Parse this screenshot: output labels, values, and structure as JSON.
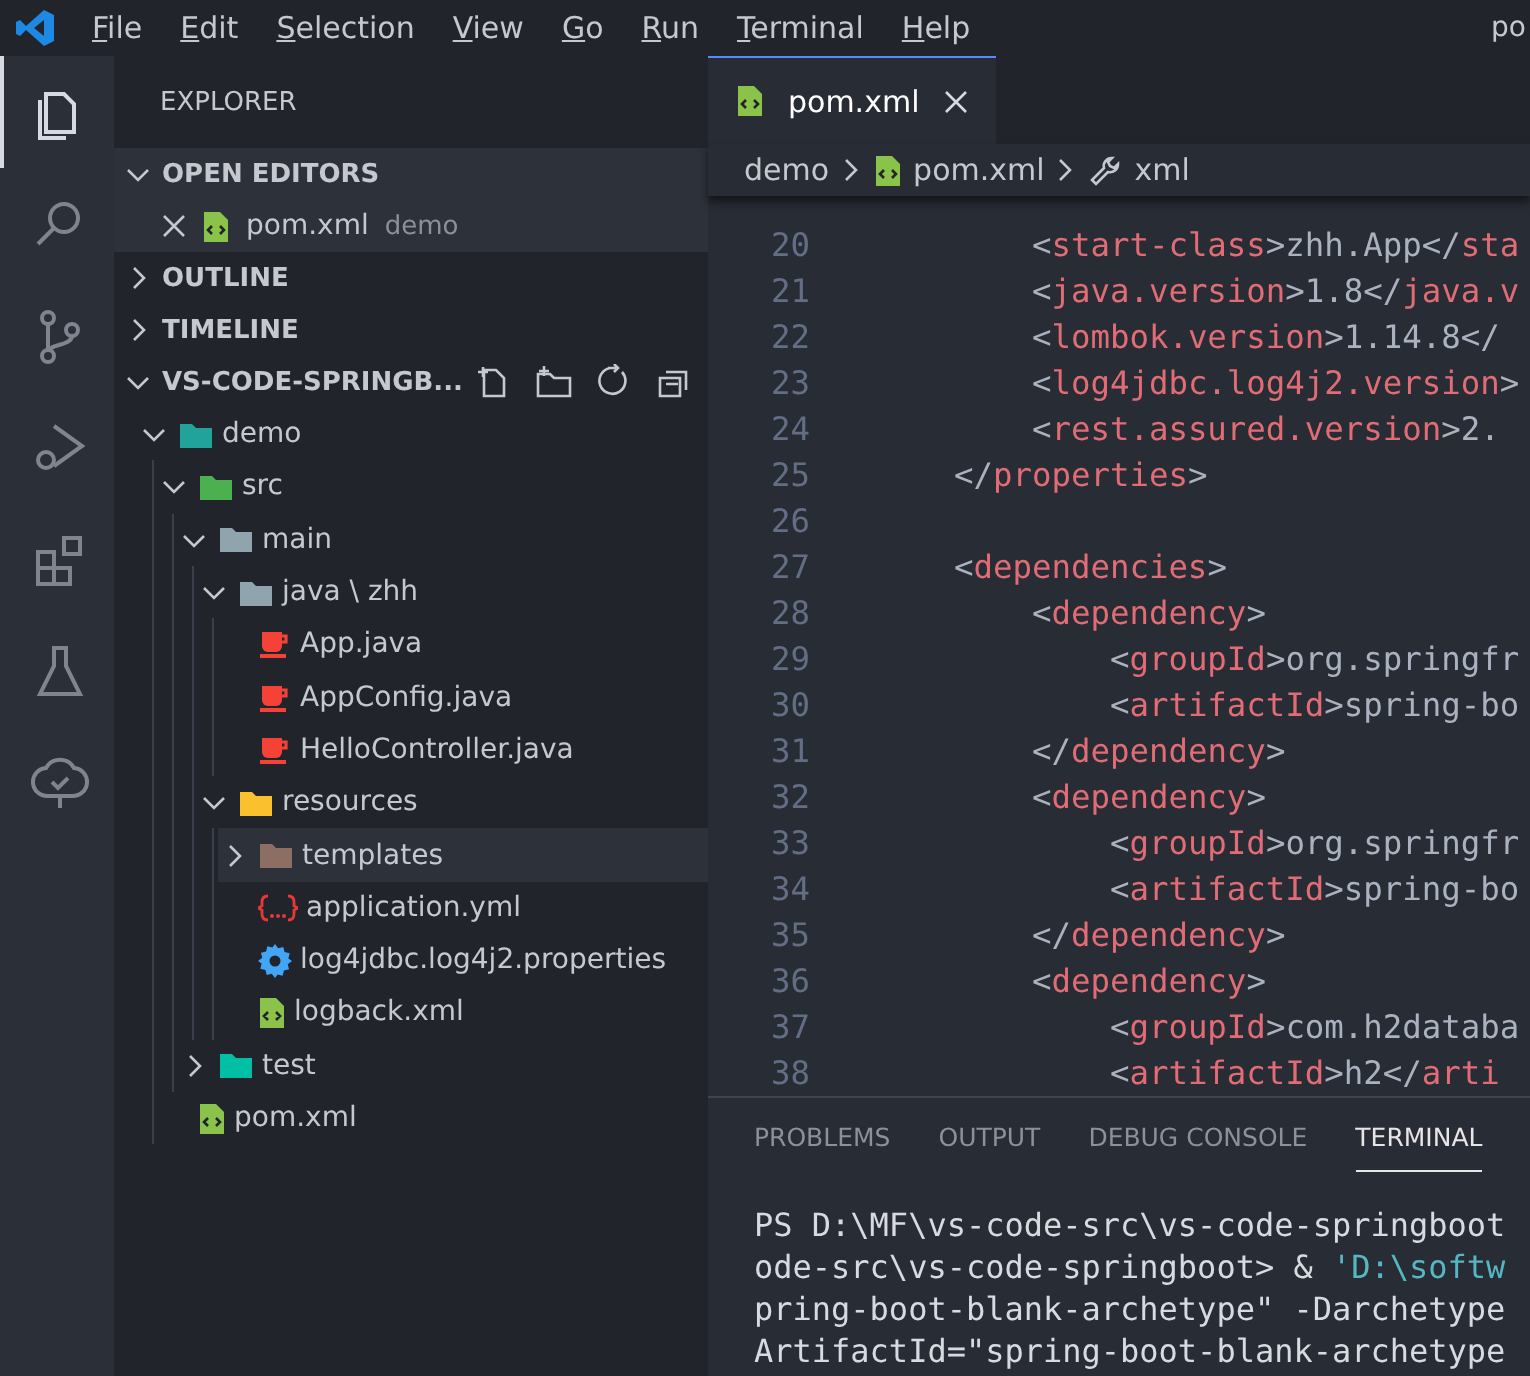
{
  "menu": [
    "File",
    "Edit",
    "Selection",
    "View",
    "Go",
    "Run",
    "Terminal",
    "Help"
  ],
  "window": {
    "title": "po"
  },
  "activity_bar": [
    {
      "kind": "files",
      "selected": true
    },
    {
      "kind": "search",
      "selected": false
    },
    {
      "kind": "scm",
      "selected": false
    },
    {
      "kind": "debug",
      "selected": false
    },
    {
      "kind": "extensions",
      "selected": false
    },
    {
      "kind": "testing",
      "selected": false
    },
    {
      "kind": "tree",
      "selected": false
    }
  ],
  "sidebar": {
    "title": "EXPLORER",
    "sections": [
      {
        "title": "OPEN EDITORS",
        "expanded": true,
        "open_editors": [
          {
            "name": "pom.xml",
            "folder": "demo"
          }
        ]
      },
      {
        "title": "OUTLINE",
        "expanded": false
      },
      {
        "title": "TIMELINE",
        "expanded": false
      },
      {
        "title": "VS-CODE-SPRINGB...",
        "expanded": true,
        "tree": [
          {
            "name": "demo",
            "kind": "folder",
            "color": "#22a39a",
            "expanded": true,
            "selected": false,
            "children": [
              {
                "name": "src",
                "kind": "folder",
                "color": "#4caf50",
                "expanded": true,
                "selected": false,
                "children": [
                  {
                    "name": "main",
                    "kind": "folder",
                    "color": "#90a4ae",
                    "expanded": true,
                    "selected": false,
                    "children": [
                      {
                        "name": "java \\ zhh",
                        "kind": "folder",
                        "color": "#90a4ae",
                        "expanded": true,
                        "selected": false,
                        "children": [
                          {
                            "name": "App.java",
                            "kind": "java",
                            "selected": false
                          },
                          {
                            "name": "AppConfig.java",
                            "kind": "java",
                            "selected": false
                          },
                          {
                            "name": "HelloController.java",
                            "kind": "java",
                            "selected": false
                          }
                        ]
                      },
                      {
                        "name": "resources",
                        "kind": "folder",
                        "color": "#fbc02d",
                        "expanded": true,
                        "selected": false,
                        "children": [
                          {
                            "name": "templates",
                            "kind": "folder",
                            "color": "#8d6e63",
                            "expanded": false,
                            "selected": true
                          },
                          {
                            "name": "application.yml",
                            "kind": "yaml",
                            "selected": false
                          },
                          {
                            "name": "log4jdbc.log4j2.properties",
                            "kind": "properties",
                            "selected": false
                          },
                          {
                            "name": "logback.xml",
                            "kind": "xml",
                            "selected": false
                          }
                        ]
                      }
                    ]
                  },
                  {
                    "name": "test",
                    "kind": "folder",
                    "color": "#00bfa5",
                    "expanded": false,
                    "selected": false
                  }
                ]
              },
              {
                "name": "pom.xml",
                "kind": "xml",
                "selected": false
              }
            ]
          }
        ]
      }
    ]
  },
  "editor": {
    "tabs": [
      {
        "name": "pom.xml",
        "selected": true
      }
    ],
    "breadcrumb": [
      "demo",
      "pom.xml",
      "xml"
    ],
    "lines": [
      {
        "number": "20",
        "segments": [
          {
            "kind": "punct",
            "text": "        <"
          },
          {
            "kind": "tag",
            "text": "start-class"
          },
          {
            "kind": "punct",
            "text": ">"
          },
          {
            "kind": "text",
            "text": "zhh.App"
          },
          {
            "kind": "punct",
            "text": "</"
          },
          {
            "kind": "tag",
            "text": "sta"
          }
        ]
      },
      {
        "number": "21",
        "segments": [
          {
            "kind": "punct",
            "text": "        <"
          },
          {
            "kind": "tag",
            "text": "java.version"
          },
          {
            "kind": "punct",
            "text": ">"
          },
          {
            "kind": "text",
            "text": "1.8"
          },
          {
            "kind": "punct",
            "text": "</"
          },
          {
            "kind": "tag",
            "text": "java.v"
          }
        ]
      },
      {
        "number": "22",
        "segments": [
          {
            "kind": "punct",
            "text": "        <"
          },
          {
            "kind": "tag",
            "text": "lombok.version"
          },
          {
            "kind": "punct",
            "text": ">"
          },
          {
            "kind": "text",
            "text": "1.14.8"
          },
          {
            "kind": "punct",
            "text": "</"
          }
        ]
      },
      {
        "number": "23",
        "segments": [
          {
            "kind": "punct",
            "text": "        <"
          },
          {
            "kind": "tag",
            "text": "log4jdbc.log4j2.version"
          },
          {
            "kind": "punct",
            "text": ">"
          }
        ]
      },
      {
        "number": "24",
        "segments": [
          {
            "kind": "punct",
            "text": "        <"
          },
          {
            "kind": "tag",
            "text": "rest.assured.version"
          },
          {
            "kind": "punct",
            "text": ">"
          },
          {
            "kind": "text",
            "text": "2."
          }
        ]
      },
      {
        "number": "25",
        "segments": [
          {
            "kind": "punct",
            "text": "    </"
          },
          {
            "kind": "tag",
            "text": "properties"
          },
          {
            "kind": "punct",
            "text": ">"
          }
        ]
      },
      {
        "number": "26"
      },
      {
        "number": "27",
        "segments": [
          {
            "kind": "punct",
            "text": "    <"
          },
          {
            "kind": "tag",
            "text": "dependencies"
          },
          {
            "kind": "punct",
            "text": ">"
          }
        ]
      },
      {
        "number": "28",
        "segments": [
          {
            "kind": "punct",
            "text": "        <"
          },
          {
            "kind": "tag",
            "text": "dependency"
          },
          {
            "kind": "punct",
            "text": ">"
          }
        ]
      },
      {
        "number": "29",
        "segments": [
          {
            "kind": "punct",
            "text": "            <"
          },
          {
            "kind": "tag",
            "text": "groupId"
          },
          {
            "kind": "punct",
            "text": ">"
          },
          {
            "kind": "text",
            "text": "org.springfr"
          }
        ]
      },
      {
        "number": "30",
        "segments": [
          {
            "kind": "punct",
            "text": "            <"
          },
          {
            "kind": "tag",
            "text": "artifactId"
          },
          {
            "kind": "punct",
            "text": ">"
          },
          {
            "kind": "text",
            "text": "spring-bo"
          }
        ]
      },
      {
        "number": "31",
        "segments": [
          {
            "kind": "punct",
            "text": "        </"
          },
          {
            "kind": "tag",
            "text": "dependency"
          },
          {
            "kind": "punct",
            "text": ">"
          }
        ]
      },
      {
        "number": "32",
        "segments": [
          {
            "kind": "punct",
            "text": "        <"
          },
          {
            "kind": "tag",
            "text": "dependency"
          },
          {
            "kind": "punct",
            "text": ">"
          }
        ]
      },
      {
        "number": "33",
        "segments": [
          {
            "kind": "punct",
            "text": "            <"
          },
          {
            "kind": "tag",
            "text": "groupId"
          },
          {
            "kind": "punct",
            "text": ">"
          },
          {
            "kind": "text",
            "text": "org.springfr"
          }
        ]
      },
      {
        "number": "34",
        "segments": [
          {
            "kind": "punct",
            "text": "            <"
          },
          {
            "kind": "tag",
            "text": "artifactId"
          },
          {
            "kind": "punct",
            "text": ">"
          },
          {
            "kind": "text",
            "text": "spring-bo"
          }
        ]
      },
      {
        "number": "35",
        "segments": [
          {
            "kind": "punct",
            "text": "        </"
          },
          {
            "kind": "tag",
            "text": "dependency"
          },
          {
            "kind": "punct",
            "text": ">"
          }
        ]
      },
      {
        "number": "36",
        "segments": [
          {
            "kind": "punct",
            "text": "        <"
          },
          {
            "kind": "tag",
            "text": "dependency"
          },
          {
            "kind": "punct",
            "text": ">"
          }
        ]
      },
      {
        "number": "37",
        "segments": [
          {
            "kind": "punct",
            "text": "            <"
          },
          {
            "kind": "tag",
            "text": "groupId"
          },
          {
            "kind": "punct",
            "text": ">"
          },
          {
            "kind": "text",
            "text": "com.h2databa"
          }
        ]
      },
      {
        "number": "38",
        "segments": [
          {
            "kind": "punct",
            "text": "            <"
          },
          {
            "kind": "tag",
            "text": "artifactId"
          },
          {
            "kind": "punct",
            "text": ">"
          },
          {
            "kind": "text",
            "text": "h2"
          },
          {
            "kind": "punct",
            "text": "</"
          },
          {
            "kind": "tag",
            "text": "arti"
          }
        ]
      }
    ]
  },
  "panel": {
    "tabs": [
      {
        "label": "PROBLEMS",
        "selected": false
      },
      {
        "label": "OUTPUT",
        "selected": false
      },
      {
        "label": "DEBUG CONSOLE",
        "selected": false
      },
      {
        "label": "TERMINAL",
        "selected": true
      }
    ],
    "terminal_lines": [
      [
        {
          "kind": "plain",
          "text": "PS D:\\MF\\vs-code-src\\vs-code-springboot"
        }
      ],
      [
        {
          "kind": "plain",
          "text": "ode-src\\vs-code-springboot> & "
        },
        {
          "kind": "string",
          "text": "'D:\\softw"
        }
      ],
      [
        {
          "kind": "plain",
          "text": "pring-boot-blank-archetype\" -Darchetype"
        }
      ],
      [
        {
          "kind": "plain",
          "text": "ArtifactId=\"spring-boot-blank-archetype"
        }
      ]
    ]
  }
}
